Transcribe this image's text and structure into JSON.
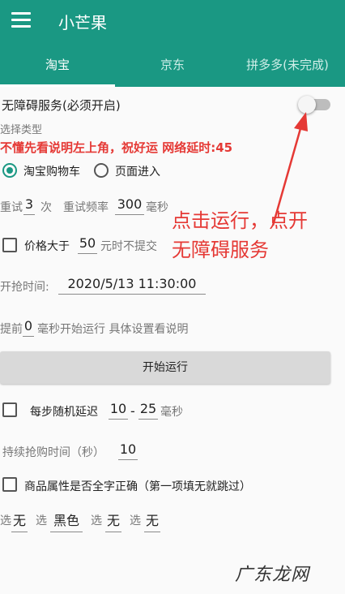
{
  "app": {
    "title": "小芒果"
  },
  "tabs": [
    {
      "label": "淘宝",
      "active": true
    },
    {
      "label": "京东",
      "active": false
    },
    {
      "label": "拼多多(未完成)",
      "active": false
    }
  ],
  "accessibility": {
    "label": "无障碍服务(必须开启)",
    "enabled": false
  },
  "select_type": {
    "label": "选择类型",
    "warning": "不懂先看说明左上角，祝好运 网络延时:45",
    "options": [
      {
        "label": "淘宝购物车",
        "checked": true
      },
      {
        "label": "页面进入",
        "checked": false
      }
    ]
  },
  "retry": {
    "label": "重试",
    "count": "3",
    "count_unit": "次",
    "freq_label": "重试频率",
    "freq": "300",
    "freq_unit": "毫秒"
  },
  "price": {
    "label": "价格大于",
    "value": "50",
    "suffix": "元时不提交"
  },
  "start_time": {
    "label": "开抢时间:",
    "value": "2020/5/13 11:30:00"
  },
  "advance": {
    "prefix": "提前",
    "value": "0",
    "suffix": "毫秒开始运行 具体设置看说明"
  },
  "start_button": {
    "label": "开始运行"
  },
  "random_delay": {
    "label": "每步随机延迟",
    "min": "10",
    "sep": "-",
    "max": "25",
    "unit": "毫秒"
  },
  "duration": {
    "label": "持续抢购时间（秒）",
    "value": "10"
  },
  "attr_match": {
    "label": "商品属性是否全字正确（第一项填无就跳过）"
  },
  "choices": [
    {
      "label": "选",
      "value": "无"
    },
    {
      "label": "选",
      "value": "黑色"
    },
    {
      "label": "选",
      "value": "无"
    },
    {
      "label": "选",
      "value": "无"
    }
  ],
  "annotation": {
    "line1": "点击运行，点开",
    "line2": "无障碍服务"
  },
  "watermark": "广东龙网",
  "colors": {
    "primary": "#1a9883",
    "warning": "#e53935",
    "button": "#d9d9d9"
  }
}
